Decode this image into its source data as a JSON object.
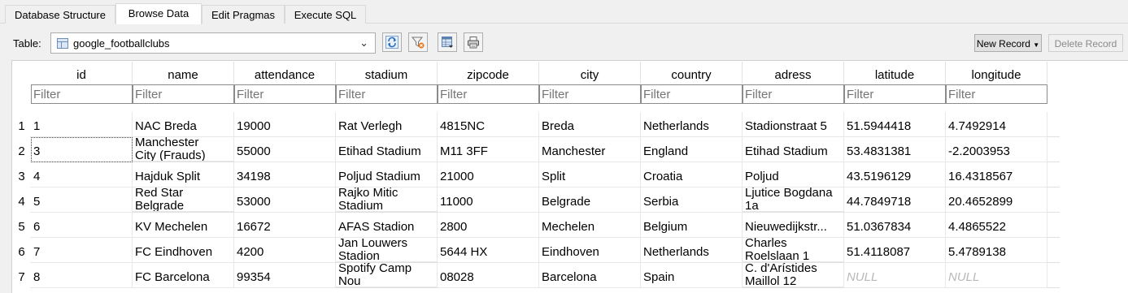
{
  "tabs": [
    {
      "label": "Database Structure",
      "active": false
    },
    {
      "label": "Browse Data",
      "active": true
    },
    {
      "label": "Edit Pragmas",
      "active": false
    },
    {
      "label": "Execute SQL",
      "active": false
    }
  ],
  "toolbar": {
    "table_label": "Table:",
    "table_value": "google_footballclubs",
    "new_record": "New Record",
    "delete_record": "Delete Record",
    "icons": [
      "refresh-icon",
      "clear-filters-icon",
      "save-table-icon",
      "print-icon"
    ]
  },
  "grid": {
    "filter_placeholder": "Filter",
    "columns": [
      "id",
      "name",
      "attendance",
      "stadium",
      "zipcode",
      "city",
      "country",
      "adress",
      "latitude",
      "longitude"
    ],
    "row_numbers": [
      "1",
      "2",
      "3",
      "4",
      "5",
      "6",
      "7"
    ],
    "rows": [
      [
        "1",
        "NAC Breda",
        "19000",
        "Rat Verlegh",
        "4815NC",
        "Breda",
        "Netherlands",
        "Stadionstraat 5",
        "51.5944418",
        "4.7492914"
      ],
      [
        "3",
        "Manchester\nCity (Frauds)",
        "55000",
        "Etihad Stadium",
        "M11 3FF",
        "Manchester",
        "England",
        "Etihad Stadium",
        "53.4831381",
        "-2.2003953"
      ],
      [
        "4",
        "Hajduk Split",
        "34198",
        "Poljud Stadium",
        "21000",
        "Split",
        "Croatia",
        "Poljud",
        "43.5196129",
        "16.4318567"
      ],
      [
        "5",
        "Red Star\nBelgrade",
        "53000",
        "Rajko Mitic\nStadium",
        "11000",
        "Belgrade",
        "Serbia",
        "Ljutice Bogdana\n1a",
        "44.7849718",
        "20.4652899"
      ],
      [
        "6",
        "KV Mechelen",
        "16672",
        "AFAS Stadion",
        "2800",
        "Mechelen",
        "Belgium",
        "Nieuwedijkstr...",
        "51.0367834",
        "4.4865522"
      ],
      [
        "7",
        "FC Eindhoven",
        "4200",
        "Jan Louwers\nStadion",
        "5644 HX",
        "Eindhoven",
        "Netherlands",
        "Charles\nRoelslaan 1",
        "51.4118087",
        "5.4789138"
      ],
      [
        "8",
        "FC Barcelona",
        "99354",
        "Spotify Camp\nNou",
        "08028",
        "Barcelona",
        "Spain",
        "C. d'Arístides\nMaillol 12",
        "NULL",
        "NULL"
      ]
    ]
  }
}
